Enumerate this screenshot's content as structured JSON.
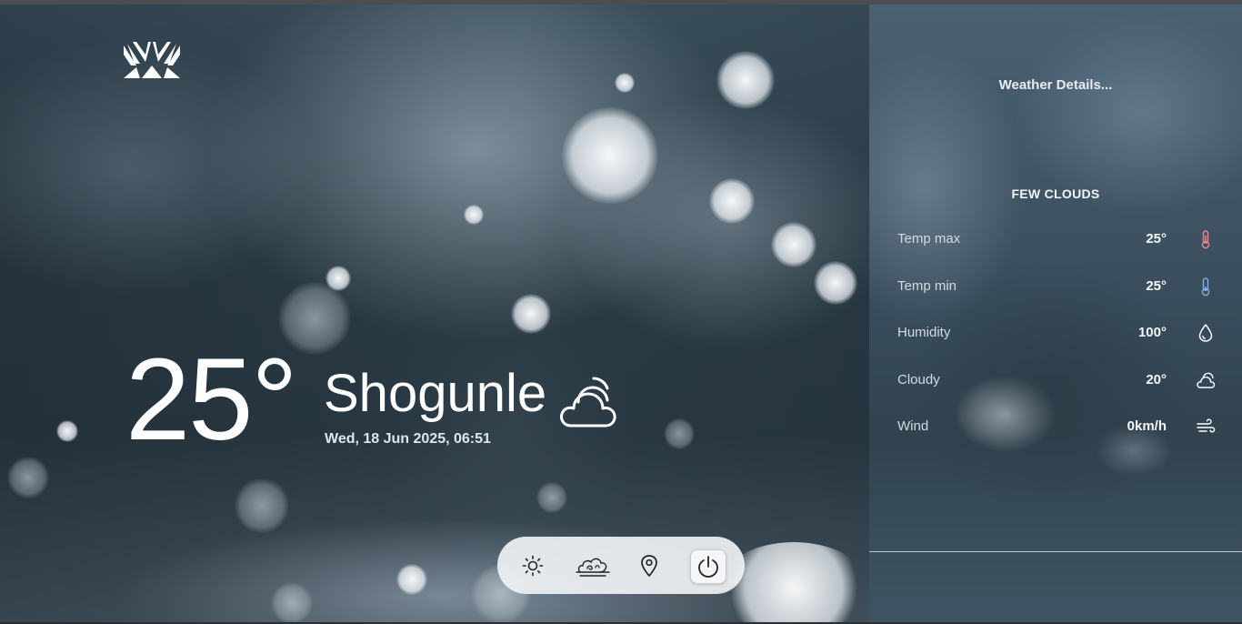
{
  "app": {
    "logo_icon": "brand-logo-icon"
  },
  "current": {
    "temperature": "25°",
    "city": "Shogunle",
    "datetime": "Wed, 18 Jun 2025, 06:51",
    "condition_icon": "cloud-icon"
  },
  "nav": {
    "items": [
      {
        "icon": "sun-icon"
      },
      {
        "icon": "clouds-icon"
      },
      {
        "icon": "location-pin-icon"
      },
      {
        "icon": "power-icon",
        "active": true
      }
    ]
  },
  "details": {
    "title": "Weather Details...",
    "condition": "FEW CLOUDS",
    "rows": [
      {
        "label": "Temp max",
        "value": "25°",
        "icon": "thermometer-hot-icon",
        "icon_color": "#e9888a"
      },
      {
        "label": "Temp min",
        "value": "25°",
        "icon": "thermometer-cold-icon",
        "icon_color": "#7fb2e8"
      },
      {
        "label": "Humidity",
        "value": "100°",
        "icon": "droplet-icon",
        "icon_color": "#ffffff"
      },
      {
        "label": "Cloudy",
        "value": "20°",
        "icon": "cloud-icon",
        "icon_color": "#ffffff"
      },
      {
        "label": "Wind",
        "value": "0km/h",
        "icon": "wind-icon",
        "icon_color": "#ffffff"
      }
    ]
  },
  "colors": {
    "panel_bg": "#3c5060",
    "nav_bg": "#f0f2f4",
    "text_primary": "#ffffff"
  }
}
